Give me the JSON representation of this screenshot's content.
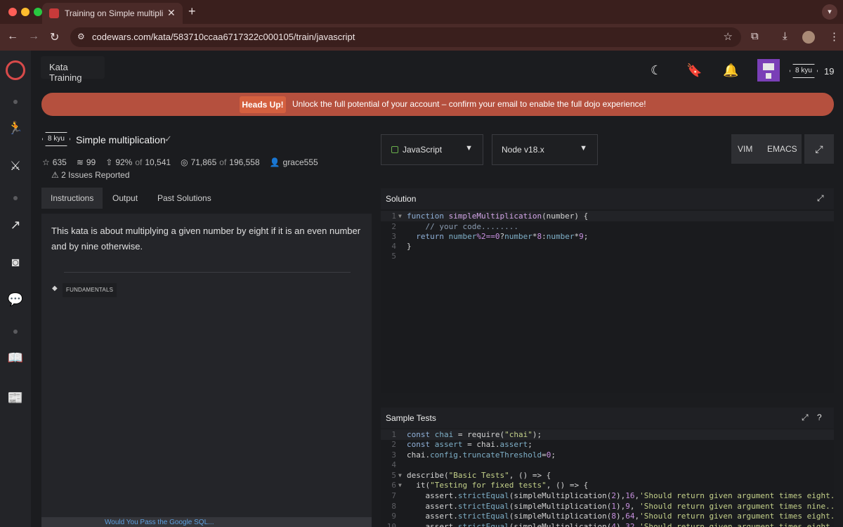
{
  "browser": {
    "tab_title": "Training on Simple multiplicat",
    "tab_close": "✕",
    "new_tab": "+",
    "url": "codewars.com/kata/583710ccaa6717322c000105/train/javascript",
    "colors": {
      "chrome": "#4a2a28",
      "tabbar": "#3a1f1d"
    }
  },
  "header": {
    "section_label": "Kata Training",
    "rank": "8 kyu",
    "honor": "19"
  },
  "banner": {
    "label": "Heads Up!",
    "text": "Unlock the full potential of your account – confirm your email to enable the full dojo experience!",
    "color": "#b5503e"
  },
  "kata": {
    "kyu": "8 kyu",
    "title": "Simple multiplication",
    "stars": "635",
    "collections": "99",
    "satisfaction": "92%",
    "satisfaction_of": "of",
    "votes": "10,541",
    "completed": "71,865",
    "completed_of": "of",
    "attempts": "196,558",
    "author": "grace555",
    "issues": "2 Issues Reported"
  },
  "tabs": [
    "Instructions",
    "Output",
    "Past Solutions"
  ],
  "instructions": {
    "text": "This kata is about multiplying a given number by eight if it is an even number and by nine otherwise.",
    "tag": "FUNDAMENTALS",
    "footer_link": "Would You Pass the Google SQL..."
  },
  "controls": {
    "language": "JavaScript",
    "runtime": "Node v18.x",
    "vim": "VIM",
    "emacs": "EMACS"
  },
  "solution": {
    "title": "Solution",
    "line_numbers": [
      "1",
      "2",
      "3",
      "4",
      "5"
    ]
  },
  "sample_tests": {
    "title": "Sample Tests",
    "line_numbers": [
      "1",
      "2",
      "3",
      "4",
      "5",
      "6",
      "7",
      "8",
      "9",
      "10"
    ]
  },
  "icons": {
    "rail": [
      "codewars-logo",
      "practice-icon",
      "dojo-icon",
      "leaderboard-icon",
      "discord-icon",
      "discussion-icon",
      "docs-icon",
      "blog-icon"
    ],
    "header": [
      "moon-icon",
      "bookmark-icon",
      "bell-icon"
    ]
  }
}
